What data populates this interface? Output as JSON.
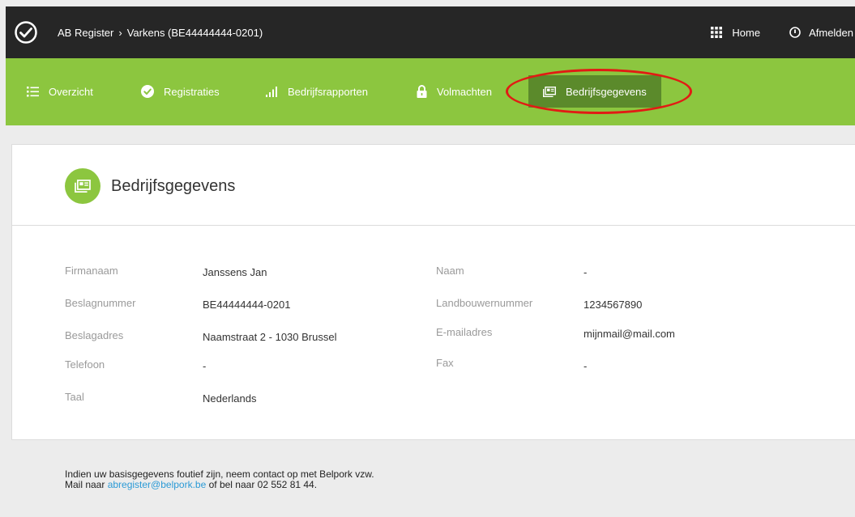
{
  "header": {
    "breadcrumb": {
      "app": "AB Register",
      "separator": "›",
      "current": "Varkens (BE44444444-0201)"
    },
    "home_label": "Home",
    "logout_label": "Afmelden"
  },
  "nav": {
    "items": [
      {
        "label": "Overzicht",
        "icon": "list-icon"
      },
      {
        "label": "Registraties",
        "icon": "check-circle-icon"
      },
      {
        "label": "Bedrijfsrapporten",
        "icon": "bar-chart-icon"
      },
      {
        "label": "Volmachten",
        "icon": "lock-icon"
      },
      {
        "label": "Bedrijfsgegevens",
        "icon": "id-card-icon",
        "active": true
      }
    ]
  },
  "page": {
    "title": "Bedrijfsgegevens"
  },
  "details": {
    "left": [
      {
        "label": "Firmanaam",
        "value": "Janssens Jan"
      },
      {
        "label": "Beslagnummer",
        "value": "BE44444444-0201"
      },
      {
        "label": "Beslagadres",
        "value": "Naamstraat 2 - 1030 Brussel"
      },
      {
        "label": "Telefoon",
        "value": "-"
      },
      {
        "label": "Taal",
        "value": "Nederlands"
      }
    ],
    "right": [
      {
        "label": "Naam",
        "value": "-"
      },
      {
        "label": "Landbouwernummer",
        "value": "1234567890"
      },
      {
        "label": "E-mailadres",
        "value": "mijnmail@mail.com"
      },
      {
        "label": "Fax",
        "value": "-"
      }
    ]
  },
  "footer_note": {
    "line1": "Indien uw basisgegevens foutief zijn, neem contact op met Belpork vzw.",
    "line2_prefix": "Mail naar ",
    "email": "abregister@belpork.be",
    "line2_suffix": " of bel naar 02 552 81 44."
  },
  "colors": {
    "brand_green": "#8cc63f",
    "active_green": "#5b8a2b",
    "header_dark": "#262626",
    "annotation_red": "#e11b14",
    "link_blue": "#2b9ad6"
  }
}
